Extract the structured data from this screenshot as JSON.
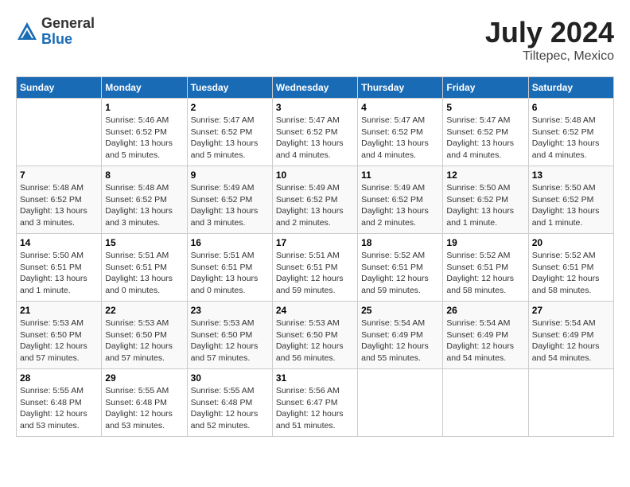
{
  "header": {
    "logo_general": "General",
    "logo_blue": "Blue",
    "title": "July 2024",
    "location": "Tiltepec, Mexico"
  },
  "columns": [
    "Sunday",
    "Monday",
    "Tuesday",
    "Wednesday",
    "Thursday",
    "Friday",
    "Saturday"
  ],
  "weeks": [
    [
      {
        "day": "",
        "sunrise": "",
        "sunset": "",
        "daylight": ""
      },
      {
        "day": "1",
        "sunrise": "Sunrise: 5:46 AM",
        "sunset": "Sunset: 6:52 PM",
        "daylight": "Daylight: 13 hours and 5 minutes."
      },
      {
        "day": "2",
        "sunrise": "Sunrise: 5:47 AM",
        "sunset": "Sunset: 6:52 PM",
        "daylight": "Daylight: 13 hours and 5 minutes."
      },
      {
        "day": "3",
        "sunrise": "Sunrise: 5:47 AM",
        "sunset": "Sunset: 6:52 PM",
        "daylight": "Daylight: 13 hours and 4 minutes."
      },
      {
        "day": "4",
        "sunrise": "Sunrise: 5:47 AM",
        "sunset": "Sunset: 6:52 PM",
        "daylight": "Daylight: 13 hours and 4 minutes."
      },
      {
        "day": "5",
        "sunrise": "Sunrise: 5:47 AM",
        "sunset": "Sunset: 6:52 PM",
        "daylight": "Daylight: 13 hours and 4 minutes."
      },
      {
        "day": "6",
        "sunrise": "Sunrise: 5:48 AM",
        "sunset": "Sunset: 6:52 PM",
        "daylight": "Daylight: 13 hours and 4 minutes."
      }
    ],
    [
      {
        "day": "7",
        "sunrise": "Sunrise: 5:48 AM",
        "sunset": "Sunset: 6:52 PM",
        "daylight": "Daylight: 13 hours and 3 minutes."
      },
      {
        "day": "8",
        "sunrise": "Sunrise: 5:48 AM",
        "sunset": "Sunset: 6:52 PM",
        "daylight": "Daylight: 13 hours and 3 minutes."
      },
      {
        "day": "9",
        "sunrise": "Sunrise: 5:49 AM",
        "sunset": "Sunset: 6:52 PM",
        "daylight": "Daylight: 13 hours and 3 minutes."
      },
      {
        "day": "10",
        "sunrise": "Sunrise: 5:49 AM",
        "sunset": "Sunset: 6:52 PM",
        "daylight": "Daylight: 13 hours and 2 minutes."
      },
      {
        "day": "11",
        "sunrise": "Sunrise: 5:49 AM",
        "sunset": "Sunset: 6:52 PM",
        "daylight": "Daylight: 13 hours and 2 minutes."
      },
      {
        "day": "12",
        "sunrise": "Sunrise: 5:50 AM",
        "sunset": "Sunset: 6:52 PM",
        "daylight": "Daylight: 13 hours and 1 minute."
      },
      {
        "day": "13",
        "sunrise": "Sunrise: 5:50 AM",
        "sunset": "Sunset: 6:52 PM",
        "daylight": "Daylight: 13 hours and 1 minute."
      }
    ],
    [
      {
        "day": "14",
        "sunrise": "Sunrise: 5:50 AM",
        "sunset": "Sunset: 6:51 PM",
        "daylight": "Daylight: 13 hours and 1 minute."
      },
      {
        "day": "15",
        "sunrise": "Sunrise: 5:51 AM",
        "sunset": "Sunset: 6:51 PM",
        "daylight": "Daylight: 13 hours and 0 minutes."
      },
      {
        "day": "16",
        "sunrise": "Sunrise: 5:51 AM",
        "sunset": "Sunset: 6:51 PM",
        "daylight": "Daylight: 13 hours and 0 minutes."
      },
      {
        "day": "17",
        "sunrise": "Sunrise: 5:51 AM",
        "sunset": "Sunset: 6:51 PM",
        "daylight": "Daylight: 12 hours and 59 minutes."
      },
      {
        "day": "18",
        "sunrise": "Sunrise: 5:52 AM",
        "sunset": "Sunset: 6:51 PM",
        "daylight": "Daylight: 12 hours and 59 minutes."
      },
      {
        "day": "19",
        "sunrise": "Sunrise: 5:52 AM",
        "sunset": "Sunset: 6:51 PM",
        "daylight": "Daylight: 12 hours and 58 minutes."
      },
      {
        "day": "20",
        "sunrise": "Sunrise: 5:52 AM",
        "sunset": "Sunset: 6:51 PM",
        "daylight": "Daylight: 12 hours and 58 minutes."
      }
    ],
    [
      {
        "day": "21",
        "sunrise": "Sunrise: 5:53 AM",
        "sunset": "Sunset: 6:50 PM",
        "daylight": "Daylight: 12 hours and 57 minutes."
      },
      {
        "day": "22",
        "sunrise": "Sunrise: 5:53 AM",
        "sunset": "Sunset: 6:50 PM",
        "daylight": "Daylight: 12 hours and 57 minutes."
      },
      {
        "day": "23",
        "sunrise": "Sunrise: 5:53 AM",
        "sunset": "Sunset: 6:50 PM",
        "daylight": "Daylight: 12 hours and 57 minutes."
      },
      {
        "day": "24",
        "sunrise": "Sunrise: 5:53 AM",
        "sunset": "Sunset: 6:50 PM",
        "daylight": "Daylight: 12 hours and 56 minutes."
      },
      {
        "day": "25",
        "sunrise": "Sunrise: 5:54 AM",
        "sunset": "Sunset: 6:49 PM",
        "daylight": "Daylight: 12 hours and 55 minutes."
      },
      {
        "day": "26",
        "sunrise": "Sunrise: 5:54 AM",
        "sunset": "Sunset: 6:49 PM",
        "daylight": "Daylight: 12 hours and 54 minutes."
      },
      {
        "day": "27",
        "sunrise": "Sunrise: 5:54 AM",
        "sunset": "Sunset: 6:49 PM",
        "daylight": "Daylight: 12 hours and 54 minutes."
      }
    ],
    [
      {
        "day": "28",
        "sunrise": "Sunrise: 5:55 AM",
        "sunset": "Sunset: 6:48 PM",
        "daylight": "Daylight: 12 hours and 53 minutes."
      },
      {
        "day": "29",
        "sunrise": "Sunrise: 5:55 AM",
        "sunset": "Sunset: 6:48 PM",
        "daylight": "Daylight: 12 hours and 53 minutes."
      },
      {
        "day": "30",
        "sunrise": "Sunrise: 5:55 AM",
        "sunset": "Sunset: 6:48 PM",
        "daylight": "Daylight: 12 hours and 52 minutes."
      },
      {
        "day": "31",
        "sunrise": "Sunrise: 5:56 AM",
        "sunset": "Sunset: 6:47 PM",
        "daylight": "Daylight: 12 hours and 51 minutes."
      },
      {
        "day": "",
        "sunrise": "",
        "sunset": "",
        "daylight": ""
      },
      {
        "day": "",
        "sunrise": "",
        "sunset": "",
        "daylight": ""
      },
      {
        "day": "",
        "sunrise": "",
        "sunset": "",
        "daylight": ""
      }
    ]
  ]
}
